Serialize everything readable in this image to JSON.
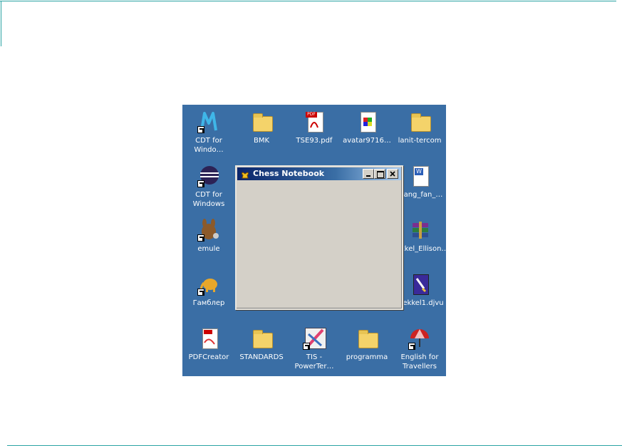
{
  "desktop": {
    "background": "#3a6ea5",
    "icons": [
      {
        "label": "CDT for\nWindo…",
        "icon": "cdt-m-icon"
      },
      {
        "label": "BMK",
        "icon": "folder-icon"
      },
      {
        "label": "TSE93.pdf",
        "icon": "pdf-icon"
      },
      {
        "label": "avatar9716…",
        "icon": "image-icon"
      },
      {
        "label": "lanit-tercom",
        "icon": "folder-icon"
      },
      {
        "label": "CDT for\nWindows",
        "icon": "eclipse-icon"
      },
      {
        "label": "…ang_fan_…",
        "icon": "word-doc-icon"
      },
      {
        "label": "emule",
        "icon": "emule-icon"
      },
      {
        "label": "…kkel_Ellison…",
        "icon": "winrar-icon"
      },
      {
        "label": "Гамблер",
        "icon": "elephant-icon"
      },
      {
        "label": "…ekkel1.djvu",
        "icon": "djvu-icon"
      },
      {
        "label": "PDFCreator",
        "icon": "pdfcreator-icon"
      },
      {
        "label": "STANDARDS",
        "icon": "folder-icon"
      },
      {
        "label": "TIS -\nPowerTer…",
        "icon": "tis-icon"
      },
      {
        "label": "programma",
        "icon": "folder-icon"
      },
      {
        "label": "English for\nTravellers",
        "icon": "umbrella-icon"
      }
    ]
  },
  "window": {
    "title": "Chess Notebook",
    "title_icon": "chess-king-icon",
    "buttons": {
      "minimize": "minimize-icon",
      "maximize": "maximize-icon",
      "close": "close-icon"
    }
  },
  "colors": {
    "accent_rule": "#2aa3a3",
    "window_face": "#d4d0c8",
    "titlebar_start": "#0a246a"
  }
}
